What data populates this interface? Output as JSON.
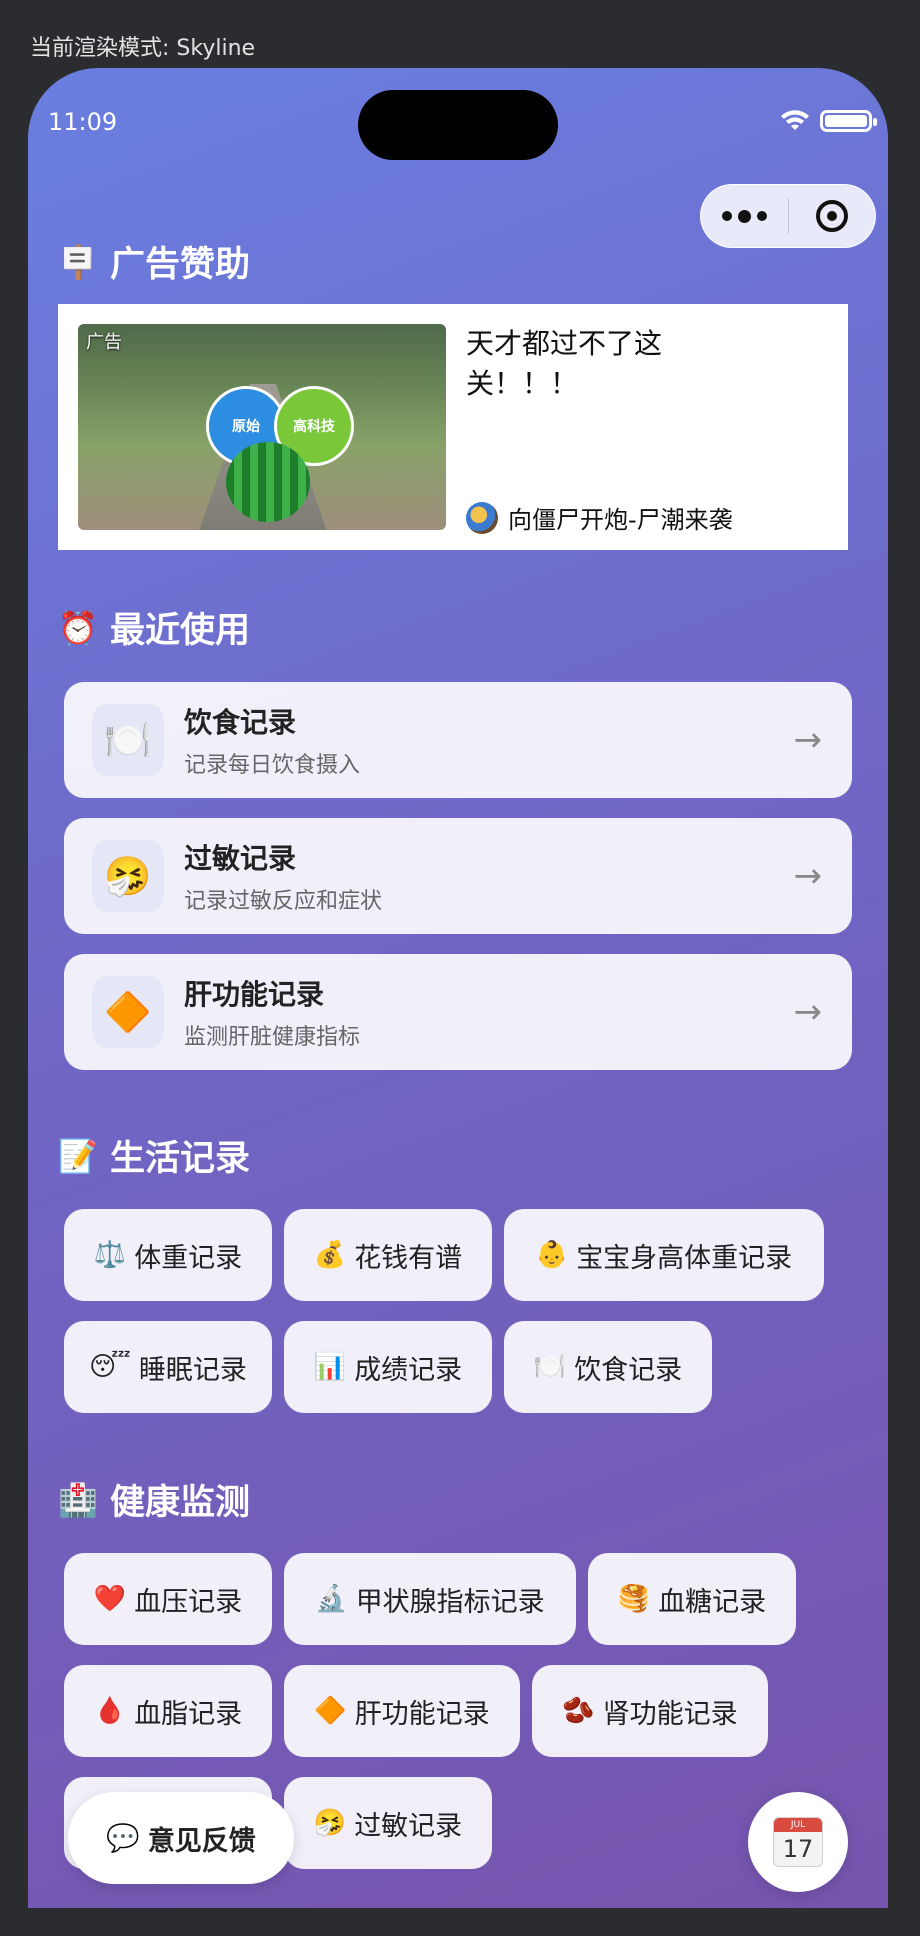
{
  "render_mode": "当前渲染模式: Skyline",
  "status_bar": {
    "time": "11:09"
  },
  "ad_section": {
    "title": "广告赞助",
    "emoji": "🪧",
    "ad": {
      "tag": "广告",
      "image_labels": [
        "原始",
        "高科技"
      ],
      "title": "天才都过不了这关！！！",
      "source": "向僵尸开炮-尸潮来袭"
    }
  },
  "recent_section": {
    "title": "最近使用",
    "emoji": "⏰",
    "items": [
      {
        "icon": "🍽️",
        "title": "饮食记录",
        "desc": "记录每日饮食摄入",
        "arrow": "→"
      },
      {
        "icon": "🤧",
        "title": "过敏记录",
        "desc": "记录过敏反应和症状",
        "arrow": "→"
      },
      {
        "icon": "🔶",
        "title": "肝功能记录",
        "desc": "监测肝脏健康指标",
        "arrow": "→"
      }
    ]
  },
  "life_section": {
    "title": "生活记录",
    "emoji": "📝",
    "items": [
      {
        "icon": "⚖️",
        "label": "体重记录"
      },
      {
        "icon": "💰",
        "label": "花钱有谱"
      },
      {
        "icon": "👶",
        "label": "宝宝身高体重记录"
      },
      {
        "icon": "😴",
        "label": "睡眠记录"
      },
      {
        "icon": "📊",
        "label": "成绩记录"
      },
      {
        "icon": "🍽️",
        "label": "饮食记录"
      }
    ]
  },
  "health_section": {
    "title": "健康监测",
    "emoji": "🏥",
    "items": [
      {
        "icon": "❤️",
        "label": "血压记录"
      },
      {
        "icon": "🔬",
        "label": "甲状腺指标记录"
      },
      {
        "icon": "🥞",
        "label": "血糖记录"
      },
      {
        "icon": "🩸",
        "label": "血脂记录"
      },
      {
        "icon": "🔶",
        "label": "肝功能记录"
      },
      {
        "icon": "🫘",
        "label": "肾功能记录"
      },
      {
        "icon": "🤧",
        "label": "过敏记录"
      }
    ]
  },
  "feedback_button": {
    "icon": "💬",
    "label": "意见反馈"
  },
  "calendar_button": {
    "month": "JUL",
    "day": "17"
  }
}
